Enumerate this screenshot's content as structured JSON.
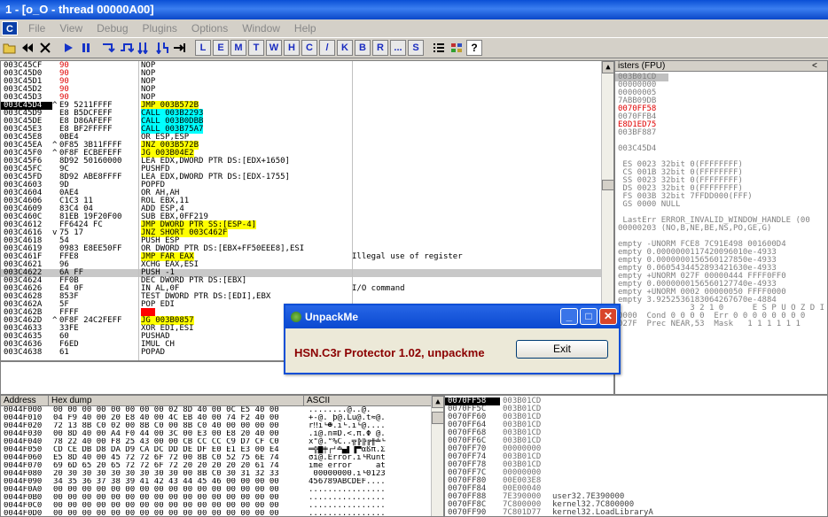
{
  "window": {
    "title": "1 - [o_O - thread 00000A00]"
  },
  "menu": {
    "app_icon": "C",
    "items": [
      "File",
      "View",
      "Debug",
      "Plugins",
      "Options",
      "Window",
      "Help"
    ]
  },
  "toolbar": {
    "letters": [
      "L",
      "E",
      "M",
      "T",
      "W",
      "H",
      "C",
      "/",
      "K",
      "B",
      "R",
      "...",
      "S"
    ]
  },
  "disasm": [
    {
      "addr": "003C45CF",
      "mark": "",
      "hex": "90",
      "dis": "NOP",
      "hl": "",
      "comment": "",
      "rowcls": ""
    },
    {
      "addr": "003C45D0",
      "mark": "",
      "hex": "90",
      "dis": "NOP",
      "hl": "",
      "comment": "",
      "rowcls": ""
    },
    {
      "addr": "003C45D1",
      "mark": "",
      "hex": "90",
      "dis": "NOP",
      "hl": "",
      "comment": "",
      "rowcls": ""
    },
    {
      "addr": "003C45D2",
      "mark": "",
      "hex": "90",
      "dis": "NOP",
      "hl": "",
      "comment": "",
      "rowcls": ""
    },
    {
      "addr": "003C45D3",
      "mark": "",
      "hex": "90",
      "dis": "NOP",
      "hl": "",
      "comment": "",
      "rowcls": ""
    },
    {
      "addr": "003C45D4",
      "mark": "^",
      "hex": "E9 5211FFFF",
      "dis": "JMP 003B572B",
      "hl": "y",
      "comment": "",
      "rowcls": "sel"
    },
    {
      "addr": "003C45D9",
      "mark": "",
      "hex": "E8 B5DCFEFF",
      "dis": "CALL 003B2293",
      "hl": "c",
      "comment": "",
      "rowcls": ""
    },
    {
      "addr": "003C45DE",
      "mark": "",
      "hex": "E8 D86AFEFF",
      "dis": "CALL 003B0DBB",
      "hl": "c",
      "comment": "",
      "rowcls": ""
    },
    {
      "addr": "003C45E3",
      "mark": "",
      "hex": "E8 BF2FFFFF",
      "dis": "CALL 003B75A7",
      "hl": "c",
      "comment": "",
      "rowcls": ""
    },
    {
      "addr": "003C45E8",
      "mark": "",
      "hex": "0BE4",
      "dis": "OR ESP,ESP",
      "hl": "",
      "comment": "",
      "rowcls": ""
    },
    {
      "addr": "003C45EA",
      "mark": "^",
      "hex": "0F85 3B11FFFF",
      "dis": "JNZ 003B572B",
      "hl": "y",
      "comment": "",
      "rowcls": ""
    },
    {
      "addr": "003C45F0",
      "mark": "^",
      "hex": "0F8F ECBEFEFF",
      "dis": "JG 003B04E2",
      "hl": "y",
      "comment": "",
      "rowcls": ""
    },
    {
      "addr": "003C45F6",
      "mark": "",
      "hex": "8D92 50160000",
      "dis": "LEA EDX,DWORD PTR DS:[EDX+1650]",
      "hl": "",
      "comment": "",
      "rowcls": ""
    },
    {
      "addr": "003C45FC",
      "mark": "",
      "hex": "9C",
      "dis": "PUSHFD",
      "hl": "",
      "comment": "",
      "rowcls": ""
    },
    {
      "addr": "003C45FD",
      "mark": "",
      "hex": "8D92 ABE8FFFF",
      "dis": "LEA EDX,DWORD PTR DS:[EDX-1755]",
      "hl": "",
      "comment": "",
      "rowcls": ""
    },
    {
      "addr": "003C4603",
      "mark": "",
      "hex": "9D",
      "dis": "POPFD",
      "hl": "",
      "comment": "",
      "rowcls": ""
    },
    {
      "addr": "003C4604",
      "mark": "",
      "hex": "0AE4",
      "dis": "OR AH,AH",
      "hl": "",
      "comment": "",
      "rowcls": ""
    },
    {
      "addr": "003C4606",
      "mark": "",
      "hex": "C1C3 11",
      "dis": "ROL EBX,11",
      "hl": "",
      "comment": "",
      "rowcls": ""
    },
    {
      "addr": "003C4609",
      "mark": "",
      "hex": "83C4 04",
      "dis": "ADD ESP,4",
      "hl": "",
      "comment": "",
      "rowcls": ""
    },
    {
      "addr": "003C460C",
      "mark": "",
      "hex": "81EB 19F20F00",
      "dis": "SUB EBX,0FF219",
      "hl": "",
      "comment": "",
      "rowcls": ""
    },
    {
      "addr": "003C4612",
      "mark": "",
      "hex": "FF6424 FC",
      "dis": "JMP DWORD PTR SS:[ESP-4]",
      "hl": "y",
      "comment": "",
      "rowcls": ""
    },
    {
      "addr": "003C4616",
      "mark": "v",
      "hex": "75 17",
      "dis": "JNZ SHORT 003C462F",
      "hl": "y",
      "comment": "",
      "rowcls": ""
    },
    {
      "addr": "003C4618",
      "mark": "",
      "hex": "54",
      "dis": "PUSH ESP",
      "hl": "",
      "comment": "",
      "rowcls": ""
    },
    {
      "addr": "003C4619",
      "mark": "",
      "hex": "0983 E8EE50FF",
      "dis": "OR DWORD PTR DS:[EBX+FF50EEE8],ESI",
      "hl": "",
      "comment": "",
      "rowcls": ""
    },
    {
      "addr": "003C461F",
      "mark": "",
      "hex": "FFE8",
      "dis": "JMP FAR EAX",
      "hl": "y",
      "comment": "Illegal use of register",
      "rowcls": ""
    },
    {
      "addr": "003C4621",
      "mark": "",
      "hex": "96",
      "dis": "XCHG EAX,ESI",
      "hl": "",
      "comment": "",
      "rowcls": ""
    },
    {
      "addr": "003C4622",
      "mark": "",
      "hex": "6A FF",
      "dis": "PUSH -1",
      "hl": "",
      "comment": "",
      "rowcls": "cur"
    },
    {
      "addr": "003C4624",
      "mark": "",
      "hex": "FF0B",
      "dis": "DEC DWORD PTR DS:[EBX]",
      "hl": "",
      "comment": "",
      "rowcls": ""
    },
    {
      "addr": "003C4626",
      "mark": "",
      "hex": "E4 0F",
      "dis": "IN AL,0F",
      "hl": "",
      "comment": "I/O command",
      "rowcls": ""
    },
    {
      "addr": "003C4628",
      "mark": "",
      "hex": "853F",
      "dis": "TEST DWORD PTR DS:[EDI],EBX",
      "hl": "",
      "comment": "",
      "rowcls": ""
    },
    {
      "addr": "003C462A",
      "mark": "",
      "hex": "5F",
      "dis": "POP EDI",
      "hl": "",
      "comment": "",
      "rowcls": ""
    },
    {
      "addr": "003C462B",
      "mark": "",
      "hex": "FFFF",
      "dis": "???",
      "hl": "r",
      "comment": "",
      "rowcls": ""
    },
    {
      "addr": "003C462D",
      "mark": "^",
      "hex": "0F8F 24C2FEFF",
      "dis": "JG 003B0857",
      "hl": "y",
      "comment": "",
      "rowcls": ""
    },
    {
      "addr": "003C4633",
      "mark": "",
      "hex": "33FE",
      "dis": "XOR EDI,ESI",
      "hl": "",
      "comment": "",
      "rowcls": ""
    },
    {
      "addr": "003C4635",
      "mark": "",
      "hex": "60",
      "dis": "PUSHAD",
      "hl": "",
      "comment": "",
      "rowcls": ""
    },
    {
      "addr": "003C4636",
      "mark": "",
      "hex": "F6ED",
      "dis": "IMUL CH",
      "hl": "",
      "comment": "",
      "rowcls": ""
    },
    {
      "addr": "003C4638",
      "mark": "",
      "hex": "61",
      "dis": "POPAD",
      "hl": "",
      "comment": "",
      "rowcls": ""
    }
  ],
  "registers": {
    "title": "isters (FPU)",
    "lines": [
      {
        "t": "003B01CD",
        "c": "#808080",
        "bg": "#c0c0c0"
      },
      {
        "t": "00000000",
        "c": "#808080",
        "bg": ""
      },
      {
        "t": "00000005",
        "c": "#808080",
        "bg": ""
      },
      {
        "t": "7ABB09DB",
        "c": "#808080",
        "bg": ""
      },
      {
        "t": "0070FF58",
        "c": "#e00000",
        "bg": ""
      },
      {
        "t": "0070FFB4",
        "c": "#808080",
        "bg": ""
      },
      {
        "t": "E8D1ED75",
        "c": "#e00000",
        "bg": ""
      },
      {
        "t": "003BF887",
        "c": "#808080",
        "bg": ""
      },
      {
        "t": "",
        "c": "#808080",
        "bg": ""
      },
      {
        "t": "003C45D4",
        "c": "#808080",
        "bg": ""
      },
      {
        "t": "",
        "c": "#808080",
        "bg": ""
      },
      {
        "t": " ES 0023 32bit 0(FFFFFFFF)",
        "c": "#808080",
        "bg": ""
      },
      {
        "t": " CS 001B 32bit 0(FFFFFFFF)",
        "c": "#808080",
        "bg": ""
      },
      {
        "t": " SS 0023 32bit 0(FFFFFFFF)",
        "c": "#808080",
        "bg": ""
      },
      {
        "t": " DS 0023 32bit 0(FFFFFFFF)",
        "c": "#808080",
        "bg": ""
      },
      {
        "t": " FS 003B 32bit 7FFDD000(FFF)",
        "c": "#808080",
        "bg": ""
      },
      {
        "t": " GS 0000 NULL",
        "c": "#808080",
        "bg": ""
      },
      {
        "t": "",
        "c": "#808080",
        "bg": ""
      },
      {
        "t": " LastErr ERROR_INVALID_WINDOW_HANDLE (00",
        "c": "#808080",
        "bg": ""
      },
      {
        "t": "00000203 (NO,B,NE,BE,NS,PO,GE,G)",
        "c": "#808080",
        "bg": ""
      },
      {
        "t": "",
        "c": "#808080",
        "bg": ""
      },
      {
        "t": "empty -UNORM FCE8 7C91E498 001600D4",
        "c": "#808080",
        "bg": ""
      },
      {
        "t": "empty 0.0000000117420096010e-4933",
        "c": "#808080",
        "bg": ""
      },
      {
        "t": "empty 0.0000000156560127850e-4933",
        "c": "#808080",
        "bg": ""
      },
      {
        "t": "empty 0.0605434452893421630e-4933",
        "c": "#808080",
        "bg": ""
      },
      {
        "t": "empty +UNORM 027F 00000444 FFFF0FF0",
        "c": "#808080",
        "bg": ""
      },
      {
        "t": "empty 0.0000000156560127740e-4933",
        "c": "#808080",
        "bg": ""
      },
      {
        "t": "empty +UNORM 0002 00000050 FFFF0000",
        "c": "#808080",
        "bg": ""
      },
      {
        "t": "empty 3.9252536183064267670e-4884",
        "c": "#808080",
        "bg": ""
      },
      {
        "t": "               3 2 1 0      E S P U O Z D I",
        "c": "#808080",
        "bg": ""
      },
      {
        "t": "0000  Cond 0 0 0 0  Err 0 0 0 0 0 0 0 0",
        "c": "#808080",
        "bg": ""
      },
      {
        "t": "027F  Prec NEAR,53  Mask   1 1 1 1 1 1",
        "c": "#808080",
        "bg": ""
      }
    ]
  },
  "dump": {
    "headers": [
      "Address",
      "Hex dump",
      "ASCII"
    ],
    "rows": [
      {
        "a": "0044F000",
        "h": "00 00 00 00 00 00 00 00 02 8D 40 00 0C E5 40 00",
        "s": "........@..@."
      },
      {
        "a": "0044F010",
        "h": "04 F9 40 00 20 E8 40 00 4C EB 40 00 74 F2 40 00",
        "s": "+-@. þ@.Lü@.t≈@."
      },
      {
        "a": "0044F020",
        "h": "72 13 8B C0 02 00 8B C0 00 8B C0 40 00 00 00 00",
        "s": "r‼ï└☻.ï└.ï└@...."
      },
      {
        "a": "0044F030",
        "h": "00 8D 40 00 A4 F0 44 00 3C 00 E3 00 E8 20 40 00",
        "s": ".ì@.ñ≡D.<.π.Φ @."
      },
      {
        "a": "0044F040",
        "h": "78 22 40 00 F8 25 43 00 00 CB CC CC C9 D7 CF C0",
        "s": "x\"@.°%C..╦╠╠╔╫╧└"
      },
      {
        "a": "0044F050",
        "h": "CD CE DB D8 DA D9 CA DC DD DE DF E0 E1 E3 00 E4",
        "s": "═╬█╪┌┘╩▄▌▐▀αßπ.Σ"
      },
      {
        "a": "0044F060",
        "h": "E5 8D 40 00 45 72 72 6F 72 00 8B C0 52 75 6E 74",
        "s": "σì@.Error.ï└Runt"
      },
      {
        "a": "0044F070",
        "h": "69 6D 65 20 65 72 72 6F 72 20 20 20 20 20 61 74",
        "s": "ime error     at"
      },
      {
        "a": "0044F080",
        "h": "20 30 30 30 30 30 30 30 30 00 8B C0 30 31 32 33",
        "s": " 00000000.ï└0123"
      },
      {
        "a": "0044F090",
        "h": "34 35 36 37 38 39 41 42 43 44 45 46 00 00 00 00",
        "s": "456789ABCDEF...."
      },
      {
        "a": "0044F0A0",
        "h": "00 00 00 00 00 00 00 00 00 00 00 00 00 00 00 00",
        "s": "................"
      },
      {
        "a": "0044F0B0",
        "h": "00 00 00 00 00 00 00 00 00 00 00 00 00 00 00 00",
        "s": "................"
      },
      {
        "a": "0044F0C0",
        "h": "00 00 00 00 00 00 00 00 00 00 00 00 00 00 00 00",
        "s": "................"
      },
      {
        "a": "0044F0D0",
        "h": "00 00 00 00 00 00 00 00 00 00 00 00 00 00 00 00",
        "s": "................"
      },
      {
        "a": "0044F0E0",
        "h": "00 00 00 00 00 00 00 00 00 00 00 00 00 00 00 00",
        "s": "................"
      },
      {
        "a": "0044F0F0",
        "h": "00 00 00 00 00 00 00 00 00 00 00 00 00 00 00 00",
        "s": "................"
      }
    ]
  },
  "stack": [
    {
      "a": "0070FF58",
      "v": "003B01CD",
      "c": "",
      "sel": true
    },
    {
      "a": "0070FF5C",
      "v": "003B01CD",
      "c": "",
      "sel": false
    },
    {
      "a": "0070FF60",
      "v": "003B01CD",
      "c": "",
      "sel": false
    },
    {
      "a": "0070FF64",
      "v": "003B01CD",
      "c": "",
      "sel": false
    },
    {
      "a": "0070FF68",
      "v": "003B01CD",
      "c": "",
      "sel": false
    },
    {
      "a": "0070FF6C",
      "v": "003B01CD",
      "c": "",
      "sel": false
    },
    {
      "a": "0070FF70",
      "v": "00000000",
      "c": "",
      "sel": false
    },
    {
      "a": "0070FF74",
      "v": "003B01CD",
      "c": "",
      "sel": false
    },
    {
      "a": "0070FF78",
      "v": "003B01CD",
      "c": "",
      "sel": false
    },
    {
      "a": "0070FF7C",
      "v": "00000000",
      "c": "",
      "sel": false
    },
    {
      "a": "0070FF80",
      "v": "00E003E8",
      "c": "",
      "sel": false
    },
    {
      "a": "0070FF84",
      "v": "00E00040",
      "c": "",
      "sel": false
    },
    {
      "a": "0070FF88",
      "v": "7E390000",
      "c": "user32.7E390000",
      "sel": false
    },
    {
      "a": "0070FF8C",
      "v": "7C800000",
      "c": "kernel32.7C800000",
      "sel": false
    },
    {
      "a": "0070FF90",
      "v": "7C801D77",
      "c": "kernel32.LoadLibraryA",
      "sel": false
    }
  ],
  "dialog": {
    "title": "UnpackMe",
    "message": "HSN.C3r Protector 1.02, unpackme",
    "button": "Exit"
  }
}
